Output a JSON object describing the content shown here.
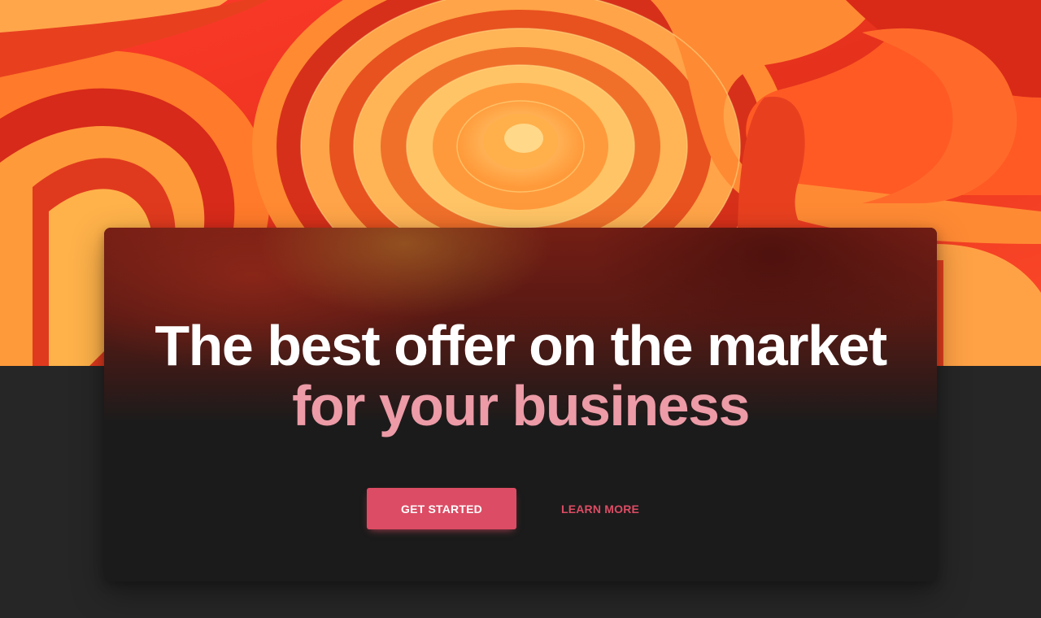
{
  "hero": {
    "headline": "The best offer on the market",
    "subheadline": "for your business"
  },
  "actions": {
    "primary_label": "GET STARTED",
    "secondary_label": "LEARN MORE"
  },
  "colors": {
    "accent": "#dc4c64",
    "subheadline": "#ec9ba7",
    "page_background": "#262626",
    "card_background": "#1b1b1b"
  }
}
